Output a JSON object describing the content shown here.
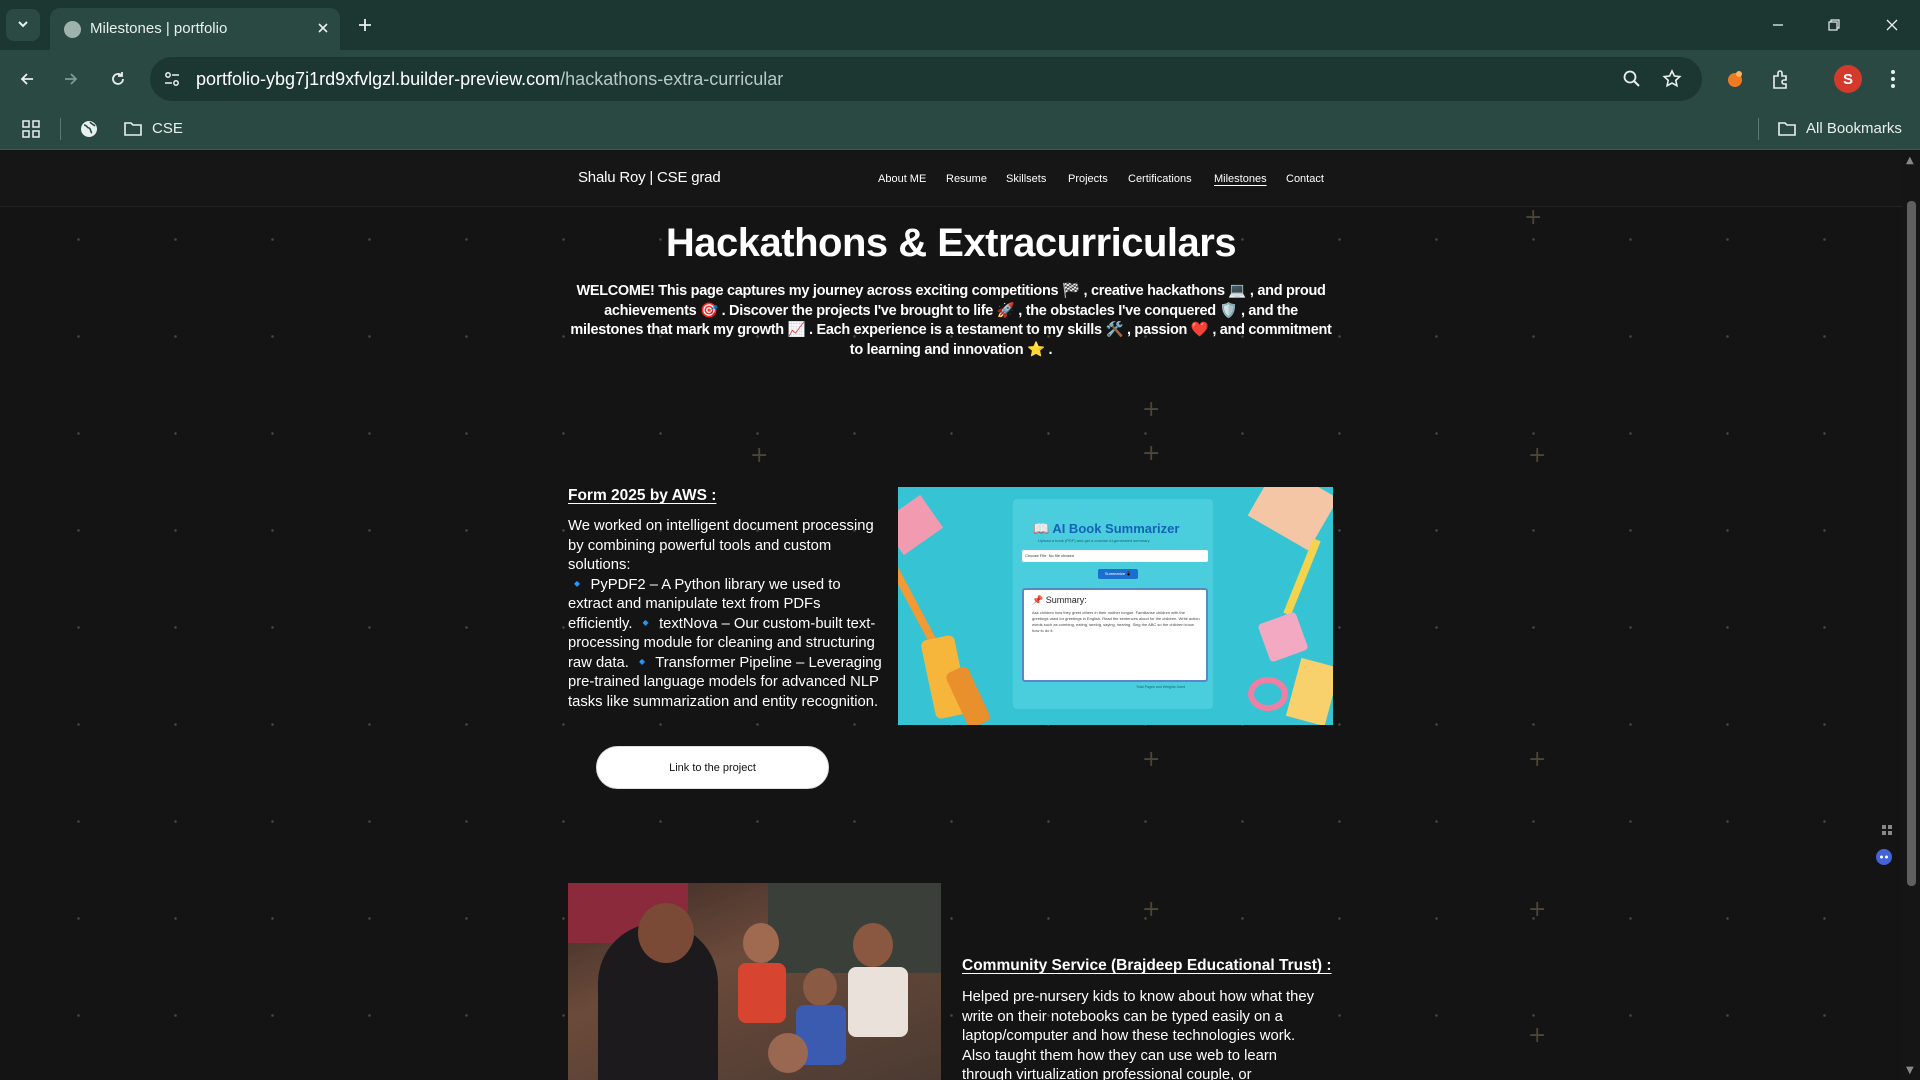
{
  "browser": {
    "tab_title": "Milestones | portfolio",
    "url_domain": "portfolio-ybg7j1rd9xfvlgzl.builder-preview.com",
    "url_path": "/hackathons-extra-curricular",
    "avatar_letter": "S",
    "bookmark_folder": "CSE",
    "all_bookmarks": "All Bookmarks"
  },
  "site": {
    "brand": "Shalu Roy | CSE grad",
    "nav": [
      "About ME",
      "Resume",
      "Skillsets",
      "Projects",
      "Certifications",
      "Milestones",
      "Contact"
    ],
    "active_nav": "Milestones"
  },
  "page": {
    "title": "Hackathons & Extracurriculars",
    "intro": "WELCOME! This page captures my journey across exciting competitions 🏁 , creative hackathons 💻 , and proud achievements 🎯 . Discover the projects I've brought to life 🚀 , the obstacles I've conquered 🛡️ , and the milestones that mark my growth 📈 . Each experience is a testament to my skills 🛠️ , passion ❤️ , and commitment to learning and innovation ⭐ ."
  },
  "sections": {
    "aws": {
      "title": "Form 2025 by AWS :",
      "body": "We worked on intelligent document processing by combining powerful tools and custom solutions:\n🔹 PyPDF2 – A Python library we used to extract and manipulate text from PDFs efficiently. 🔹 textNova – Our custom-built text-processing module for cleaning and structuring raw data. 🔹 Transformer Pipeline – Leveraging pre-trained language models for advanced NLP tasks like summarization and entity recognition.",
      "button": "Link to the project",
      "image": {
        "app_title": "📖 AI Book Summarizer",
        "app_subtitle": "Upload a book (PDF) and get a concise AI-generated summary",
        "file_button": "Choose File",
        "file_status": "No file chosen",
        "summarize_button": "Summarize 📱",
        "summary_label": "📌 Summary:",
        "summary_text": "Ask children how they greet others in their mother tongue. Familiarise children with the greetings used for greetings in English. Read the sentences aloud for the children. Write action words such as combing, eating, seeing, saying, hearing. Sing the ABC so the children know how to do it.",
        "credit": "Total Pages and Weights Used"
      }
    },
    "community": {
      "title": "Community Service (Brajdeep Educational Trust) :",
      "body": "Helped pre-nursery kids to know about how what they write on their notebooks can be typed easily on a laptop/computer and how these technologies work. Also taught them how they can use web to learn through virtualization professional couple, or"
    }
  },
  "icons": {
    "tab_list": "chevron-down-icon",
    "back": "arrow-left-icon",
    "forward": "arrow-right-icon",
    "reload": "reload-icon",
    "site_info": "tune-icon",
    "zoom": "search-icon",
    "bookmark_star": "star-icon",
    "extension_brave": "extension-icon",
    "extensions": "puzzle-icon",
    "menu": "kebab-menu-icon",
    "apps": "apps-grid-icon",
    "globe": "globe-icon",
    "folder": "folder-icon"
  },
  "colors": {
    "chrome_dark": "#1c3732",
    "chrome_light": "#2a4942",
    "page_bg": "#141414",
    "avatar": "#d33a2c",
    "card_cyan": "#36c3d4"
  }
}
